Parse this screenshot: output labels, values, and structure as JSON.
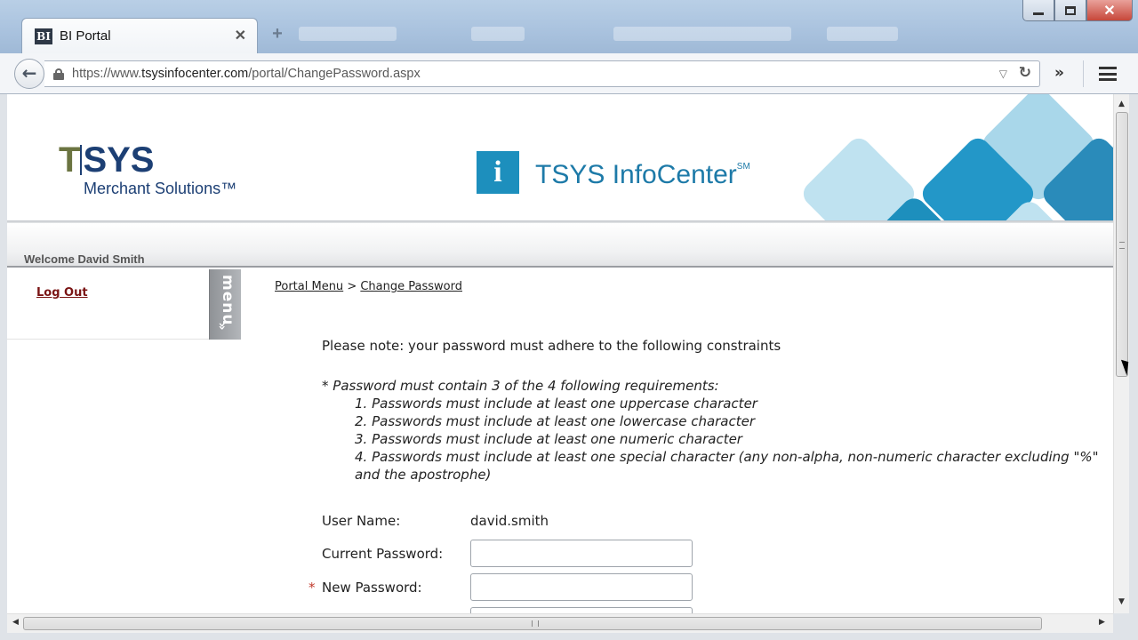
{
  "browser": {
    "tab_title": "BI Portal",
    "favicon_text": "BI",
    "tab_close": "✕",
    "new_tab": "+",
    "url_scheme": "https://www.",
    "url_host": "tsysinfocenter.com",
    "url_path": "/portal/ChangePassword.aspx",
    "back_glyph": "←",
    "reload_glyph": "↻",
    "dropdown_glyph": "▽",
    "overflow_glyph": "»",
    "close_glyph": "✕"
  },
  "header": {
    "logo_t": "T",
    "logo_sys": "SYS",
    "logo_sub": "Merchant Solutions™",
    "infocenter_badge": "i",
    "infocenter_title": "TSYS InfoCenter",
    "infocenter_mark": "SM",
    "welcome": "Welcome David Smith"
  },
  "sidebar": {
    "logout": "Log Out",
    "menu_label": "menu",
    "menu_arrows": "»"
  },
  "breadcrumb": {
    "home": "Portal Menu",
    "separator": " > ",
    "current": "Change Password"
  },
  "content": {
    "note": "Please note: your password must adhere to the following constraints",
    "requirement_intro": "* Password must contain 3 of the 4 following requirements:",
    "requirements": [
      "1. Passwords must include at least one uppercase character",
      "2. Passwords must include at least one lowercase character",
      "3. Passwords must include at least one numeric character",
      "4. Passwords must include at least one special character (any non-alpha, non-numeric character excluding \"%\" and the apostrophe)"
    ]
  },
  "form": {
    "username_label": "User Name:",
    "username_value": "david.smith",
    "current_password_label": "Current Password:",
    "current_password_value": "",
    "new_password_label": "New Password:",
    "new_password_value": "",
    "required_marker": "*"
  },
  "scrollbars": {
    "up": "▲",
    "down": "▼",
    "left": "◀",
    "right": "▶"
  },
  "colors": {
    "brand_navy": "#1c3f74",
    "brand_olive": "#6b7441",
    "infocenter_blue": "#1d8fbd",
    "logout_red": "#7a1414"
  }
}
